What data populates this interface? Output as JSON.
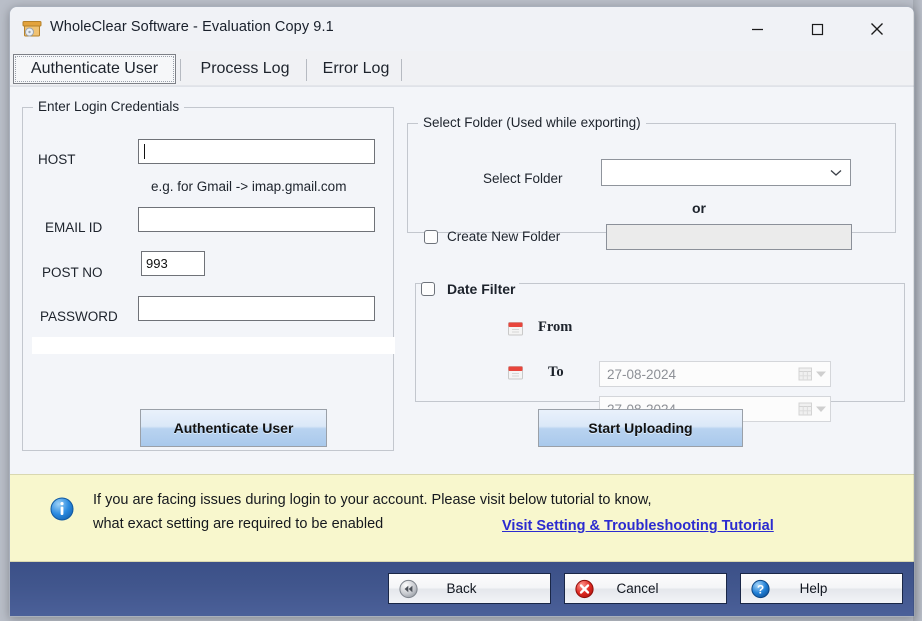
{
  "window": {
    "title": "WholeClear Software - Evaluation Copy 9.1",
    "app_icon": "archive-box-icon",
    "minimize_label": "minimize-icon",
    "maximize_label": "maximize-icon",
    "close_label": "close-icon"
  },
  "tabs": [
    {
      "label": "Authenticate User",
      "selected": true
    },
    {
      "label": "Process Log",
      "selected": false
    },
    {
      "label": "Error Log",
      "selected": false
    }
  ],
  "credentials": {
    "legend": "Enter Login Credentials",
    "host_label": "HOST",
    "host_value": "",
    "host_placeholder": "",
    "host_hint": "e.g. for Gmail -> imap.gmail.com",
    "email_label": "EMAIL ID",
    "email_value": "",
    "port_label": "POST NO",
    "port_value": "993",
    "password_label": "PASSWORD",
    "password_value": "",
    "authenticate_button": "Authenticate User"
  },
  "folder": {
    "legend": "Select Folder (Used while exporting)",
    "select_label": "Select Folder",
    "selected_value": "",
    "dropdown_icon": "chevron-down-icon",
    "or_text": "or",
    "create_checkbox_label": "Create New Folder",
    "create_checked": false,
    "create_value": ""
  },
  "date_filter": {
    "legend": "Date Filter",
    "checked": false,
    "from_label": "From",
    "from_value": "27-08-2024",
    "to_label": "To",
    "to_value": "27-08-2024",
    "calendar_icon": "calendar-icon",
    "dropdown_icon": "chevron-down-icon",
    "start_button": "Start Uploading"
  },
  "notice": {
    "icon": "info-icon",
    "line1": "If you are facing issues during login to your account. Please visit below tutorial to know,",
    "line2": "what exact setting are required to be enabled",
    "link": "Visit Setting & Troubleshooting Tutorial"
  },
  "footer": {
    "buttons": [
      {
        "label": "Back",
        "icon": "rewind-icon"
      },
      {
        "label": "Cancel",
        "icon": "cancel-icon"
      },
      {
        "label": "Help",
        "icon": "question-icon"
      }
    ]
  },
  "colors": {
    "accent_blue": "#3b5088",
    "notice_bg": "#f8f7cd",
    "link": "#2b2bd0",
    "panel_bg": "#f3f5f9"
  }
}
